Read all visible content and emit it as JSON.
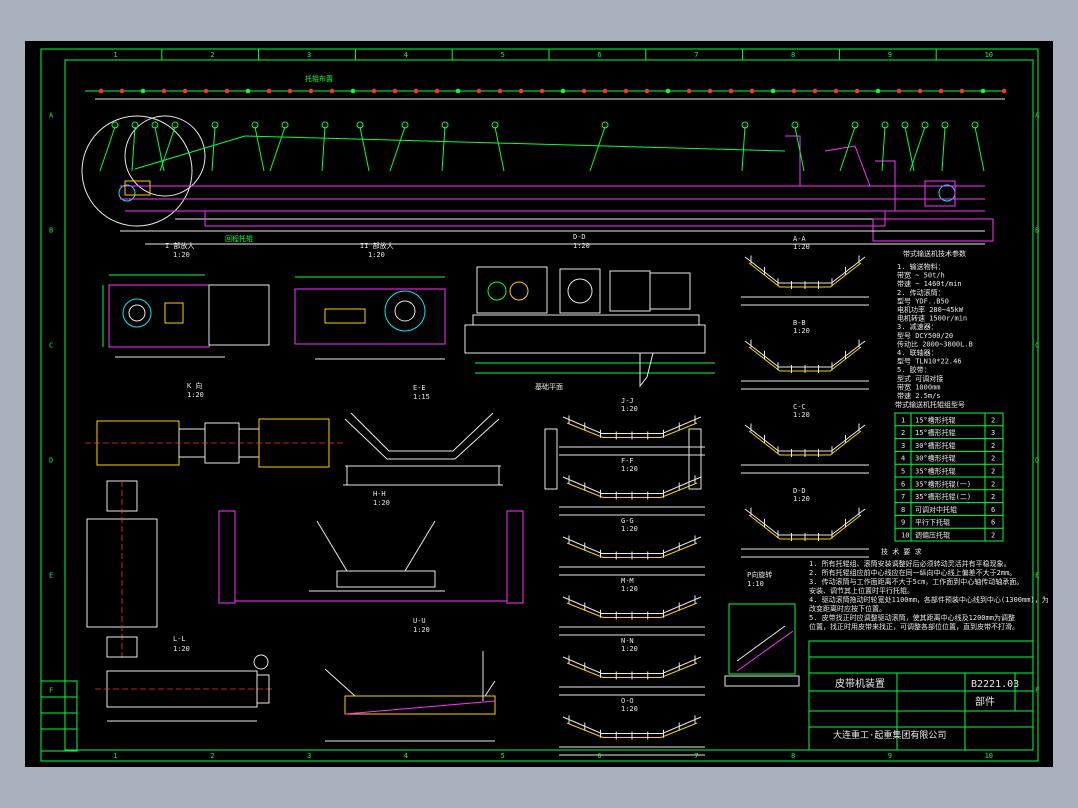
{
  "drawing": {
    "grid_columns": [
      "1",
      "2",
      "3",
      "4",
      "5",
      "6",
      "7",
      "8",
      "9",
      "10"
    ],
    "grid_rows": [
      "A",
      "B",
      "C",
      "D",
      "E",
      "F"
    ],
    "main_view_labels": [
      "托辊布置",
      "回程托辊"
    ],
    "details": {
      "detail_1": {
        "title": "I 部放大",
        "scale": "1:20"
      },
      "detail_2": {
        "title": "II 部放大",
        "scale": "1:20"
      },
      "section_D": {
        "title": "D-D",
        "scale": "1:20"
      },
      "section_K": {
        "title": "K 向",
        "scale": "1:20"
      },
      "section_E": {
        "title": "E-E",
        "scale": "1:15"
      },
      "section_H": {
        "title": "H-H",
        "scale": "1:20"
      },
      "section_L": {
        "title": "L-L",
        "scale": "1:20"
      },
      "section_U": {
        "title": "U-U",
        "scale": "1:20"
      },
      "section_P": {
        "title": "P向旋转",
        "scale": "1:10"
      },
      "base_note": "基础平面"
    },
    "troughs_right": [
      {
        "title": "A-A",
        "scale": "1:20"
      },
      {
        "title": "B-B",
        "scale": "1:20"
      },
      {
        "title": "C-C",
        "scale": "1:20"
      },
      {
        "title": "D-D",
        "scale": "1:20"
      }
    ],
    "troughs_mid": [
      {
        "title": "J-J",
        "scale": "1:20"
      },
      {
        "title": "F-F",
        "scale": "1:20"
      },
      {
        "title": "G-G",
        "scale": "1:20"
      },
      {
        "title": "M-M",
        "scale": "1:20"
      },
      {
        "title": "N-N",
        "scale": "1:20"
      },
      {
        "title": "O-O",
        "scale": "1:20"
      }
    ],
    "tech_params": {
      "title": "带式输送机技术参数",
      "lines": [
        "1. 输送物料：",
        "   带宽         ~ 50t/h",
        "   带速         ~ 1460t/min",
        "2. 传动滚筒：",
        "   型号         YDF..B50",
        "   电机功率     280~45kW",
        "   电机转速     1500r/min",
        "3. 减速器：",
        "   型号         DCY500/20",
        "   传动比       2000~3800L.B",
        "4. 联轴器：",
        "   型号         TLN10*22.46",
        "5. 胶带：",
        "   型式         可调对接",
        "   带宽         1000mm",
        "   带速         2.5m/s"
      ]
    },
    "roller_table": {
      "title": "带式输送机托辊组型号",
      "rows": [
        {
          "no": "1",
          "name": "15°槽形托辊",
          "qty": "2"
        },
        {
          "no": "2",
          "name": "15°槽形托辊",
          "qty": "3"
        },
        {
          "no": "3",
          "name": "30°槽形托辊",
          "qty": "2"
        },
        {
          "no": "4",
          "name": "30°槽形托辊",
          "qty": "2"
        },
        {
          "no": "5",
          "name": "35°槽形托辊",
          "qty": "2"
        },
        {
          "no": "6",
          "name": "35°槽形托辊(一)",
          "qty": "2"
        },
        {
          "no": "7",
          "name": "35°槽形托辊(二)",
          "qty": "2"
        },
        {
          "no": "8",
          "name": "可调对中托辊",
          "qty": "6"
        },
        {
          "no": "9",
          "name": "平行下托辊",
          "qty": "6"
        },
        {
          "no": "10",
          "name": "调偏压托辊",
          "qty": "2"
        }
      ]
    },
    "requirements": {
      "title": "技 术 要 求",
      "lines": [
        "1. 所有托辊组、滚筒安装调整好后必须转动灵活并有平稳现象。",
        "2. 所有托辊组应前中心线应在同一纵向中心线上偏差不大于2mm。",
        "3. 传动滚筒与工作面距离不大于5cm，工作面到中心轴传动轴承面。",
        "   安装、调节其上位置时平行托辊。",
        "4. 驱动滚筒拖动时轮宽处1100mm，各部件预装中心线到中心(1300mm)，为",
        "   改变距离时应按下位置。",
        "5. 皮带找正时应调整驱动滚筒，使其距离中心线及1200mm为调整",
        "   位置，找正时用皮带来找正，可调整各部位位置，直到皮带不打滑。"
      ]
    },
    "title_block": {
      "drawing_name": "皮带机装置",
      "drawing_no": "B2221.03",
      "type": "部件",
      "company": "大连重工·起重集团有限公司"
    }
  }
}
